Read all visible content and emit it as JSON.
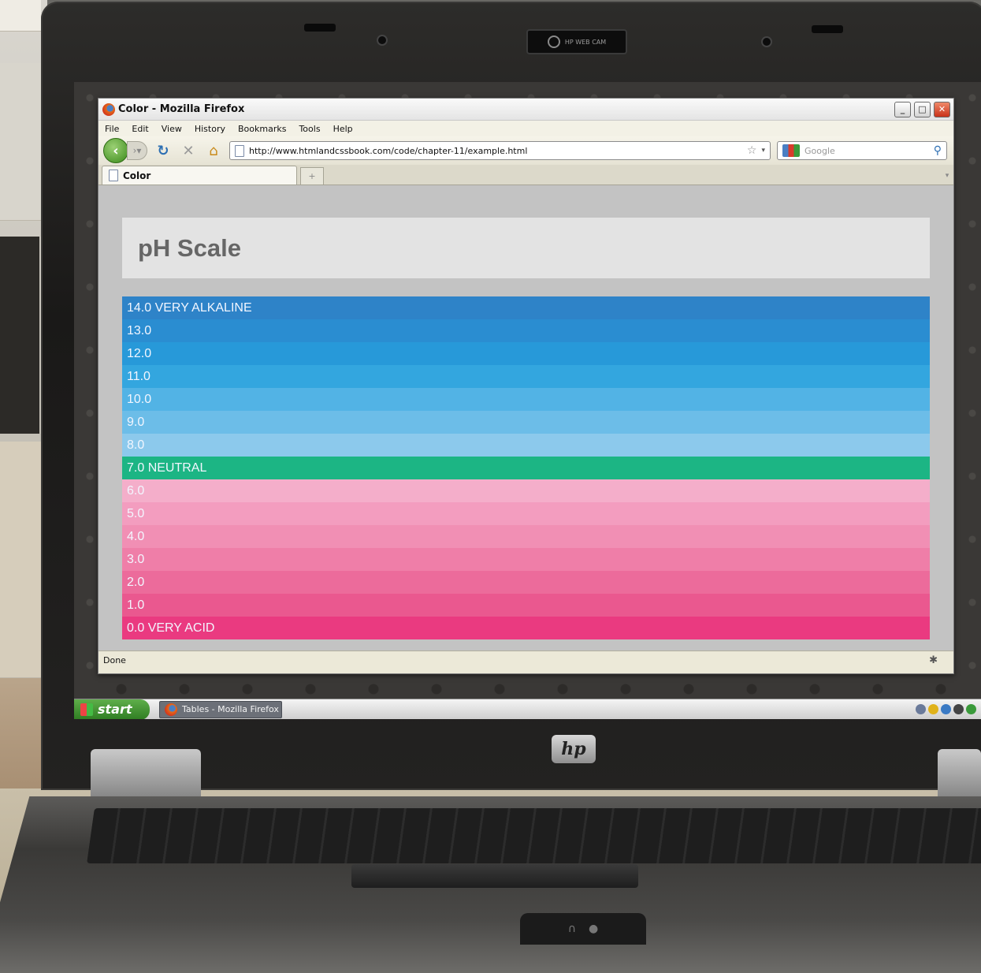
{
  "window": {
    "title": "Color - Mozilla Firefox",
    "minimize": "_",
    "maximize": "□",
    "close": "✕"
  },
  "menu": [
    "File",
    "Edit",
    "View",
    "History",
    "Bookmarks",
    "Tools",
    "Help"
  ],
  "navbar": {
    "url": "http://www.htmlandcssbook.com/code/chapter-11/example.html",
    "search_placeholder": "Google"
  },
  "tab": {
    "label": "Color"
  },
  "page": {
    "heading": "pH Scale",
    "rows": [
      {
        "label": "14.0 VERY ALKALINE",
        "color": "#2e83c8"
      },
      {
        "label": "13.0",
        "color": "#2a8dd1"
      },
      {
        "label": "12.0",
        "color": "#2799d9"
      },
      {
        "label": "11.0",
        "color": "#33a6df"
      },
      {
        "label": "10.0",
        "color": "#52b3e5"
      },
      {
        "label": "9.0",
        "color": "#6cbde8"
      },
      {
        "label": "8.0",
        "color": "#8cc9ec"
      },
      {
        "label": "7.0 NEUTRAL",
        "color": "#1cb584"
      },
      {
        "label": "6.0",
        "color": "#f4aeca"
      },
      {
        "label": "5.0",
        "color": "#f39dbf"
      },
      {
        "label": "4.0",
        "color": "#f18fb4"
      },
      {
        "label": "3.0",
        "color": "#ef7ea8"
      },
      {
        "label": "2.0",
        "color": "#ec6b9b"
      },
      {
        "label": "1.0",
        "color": "#ea588f"
      },
      {
        "label": "0.0 VERY ACID",
        "color": "#ea3a80"
      }
    ]
  },
  "status": {
    "text": "Done"
  },
  "taskbar": {
    "start_label": "start",
    "task_label": "Tables - Mozilla Firefox"
  },
  "device": {
    "webcam_label": "HP WEB CAM",
    "logo": "hp"
  }
}
